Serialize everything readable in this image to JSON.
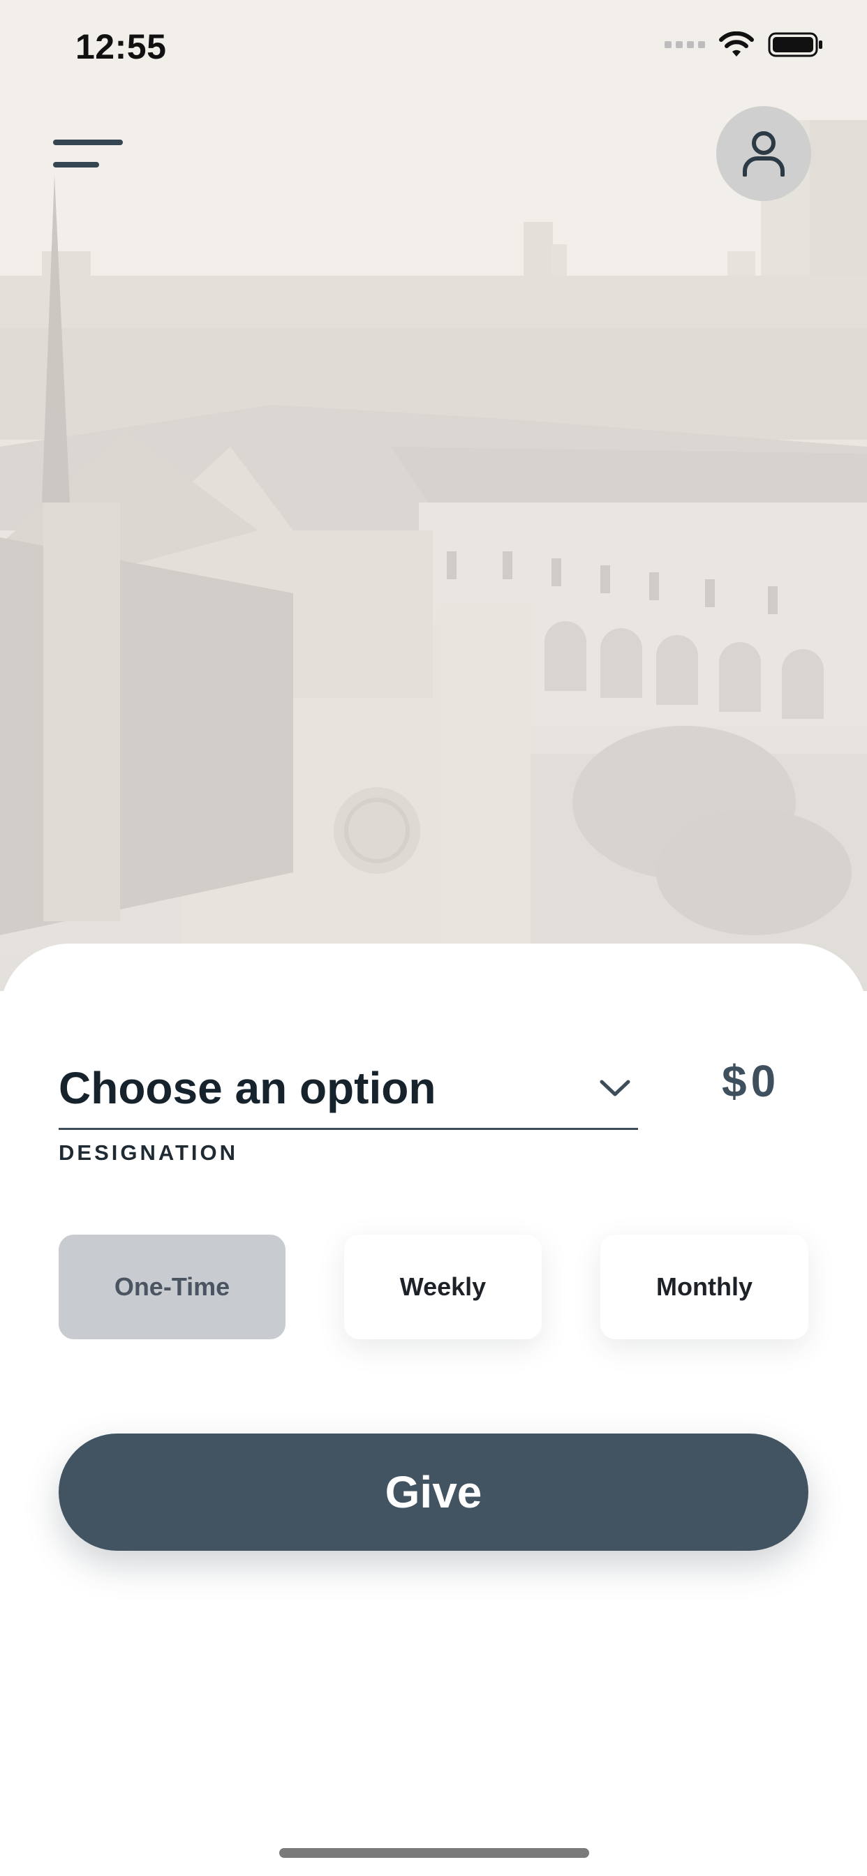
{
  "status_bar": {
    "time": "12:55"
  },
  "header": {
    "menu_icon": "hamburger-menu-icon",
    "profile_icon": "user-icon"
  },
  "give_form": {
    "designation": {
      "value": "Choose an option",
      "label": "DESIGNATION",
      "icon": "chevron-down-icon"
    },
    "amount": "$0",
    "frequency": {
      "options": [
        "One-Time",
        "Weekly",
        "Monthly"
      ],
      "selected": "One-Time"
    },
    "submit_label": "Give"
  },
  "colors": {
    "primary": "#425361",
    "selected_option_bg": "#c8cbd0",
    "text_dark": "#16232c"
  }
}
